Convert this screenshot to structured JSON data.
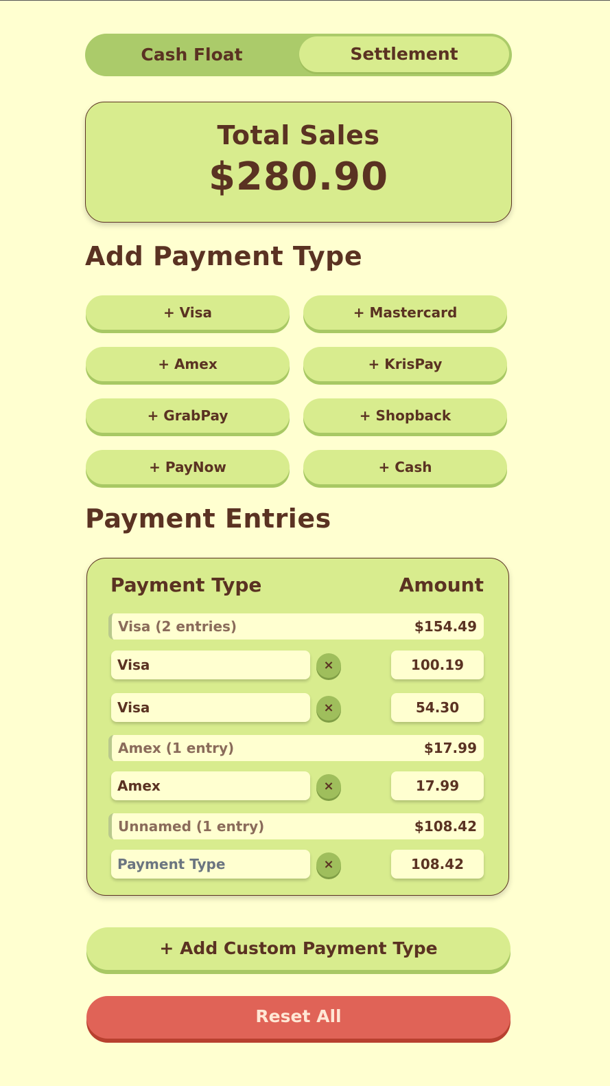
{
  "tabs": {
    "cash_float": "Cash Float",
    "settlement": "Settlement",
    "active": "Settlement"
  },
  "total": {
    "title": "Total Sales",
    "value": "$280.90"
  },
  "add_payment": {
    "heading": "Add Payment Type",
    "buttons": [
      "+ Visa",
      "+ Mastercard",
      "+ Amex",
      "+ KrisPay",
      "+ GrabPay",
      "+ Shopback",
      "+ PayNow",
      "+ Cash"
    ]
  },
  "entries": {
    "heading": "Payment Entries",
    "col_type": "Payment Type",
    "col_amount": "Amount",
    "groups": [
      {
        "label": "Visa (2 entries)",
        "total": "$154.49",
        "items": [
          {
            "name": "Visa",
            "amount": "100.19"
          },
          {
            "name": "Visa",
            "amount": "54.30"
          }
        ]
      },
      {
        "label": "Amex (1 entry)",
        "total": "$17.99",
        "items": [
          {
            "name": "Amex",
            "amount": "17.99"
          }
        ]
      },
      {
        "label": "Unnamed (1 entry)",
        "total": "$108.42",
        "items": [
          {
            "name": "",
            "placeholder": "Payment Type",
            "amount": "108.42"
          }
        ]
      }
    ],
    "remove_icon": "×"
  },
  "custom_button": "+ Add Custom Payment Type",
  "reset_button": "Reset All",
  "colors": {
    "background": "#ffffd0",
    "panel": "#d8ec8e",
    "accent_green": "#abcb6a",
    "text": "#5a3222",
    "danger": "#e06357"
  }
}
